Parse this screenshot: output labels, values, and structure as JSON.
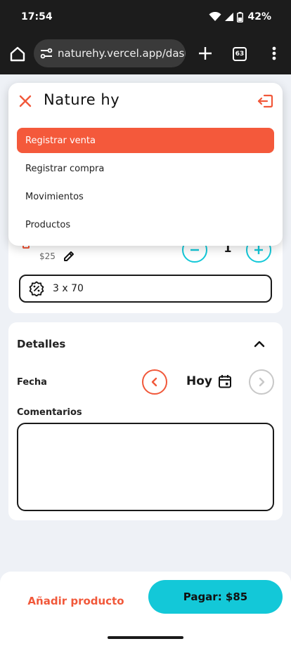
{
  "status_bar": {
    "time": "17:54",
    "battery": "42%",
    "icons": [
      "wifi-icon",
      "signal-icon",
      "battery-icon"
    ]
  },
  "browser": {
    "url": "naturehy.vercel.app/dash",
    "tab_count": "63"
  },
  "nav": {
    "brand": "Nature hy",
    "items": [
      {
        "label": "Registrar venta",
        "active": true
      },
      {
        "label": "Registrar compra",
        "active": false
      },
      {
        "label": "Movimientos",
        "active": false
      },
      {
        "label": "Productos",
        "active": false
      }
    ]
  },
  "product": {
    "price": "$25",
    "quantity": "1",
    "promotion": "3 x 70"
  },
  "details": {
    "title": "Detalles",
    "fecha_label": "Fecha",
    "date_value": "Hoy",
    "comentarios_label": "Comentarios",
    "comentarios_value": ""
  },
  "footer": {
    "add_product_label": "Añadir producto",
    "pay_label": "Pagar: $85"
  },
  "colors": {
    "accent_orange": "#f4593b",
    "accent_cyan": "#13c8d8",
    "background": "#eef1f6"
  }
}
